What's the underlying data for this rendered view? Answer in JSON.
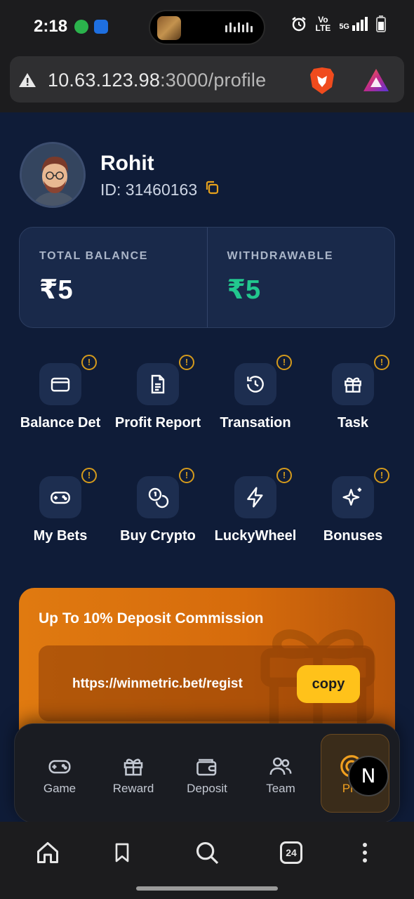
{
  "status_bar": {
    "time": "2:18",
    "network": "5G",
    "volte_line1": "Vo",
    "volte_line2": "LTE"
  },
  "browser": {
    "url_host": "10.63.123.98",
    "url_port": ":3000",
    "url_path": "/profile",
    "tab_count": "24"
  },
  "profile": {
    "name": "Rohit",
    "id_text": "ID: 31460163"
  },
  "balance": {
    "total_label": "TOTAL BALANCE",
    "total_value": "₹5",
    "withdrawable_label": "WITHDRAWABLE",
    "withdrawable_value": "₹5"
  },
  "menu": [
    {
      "label": "Balance Det",
      "icon": "credit-card-icon"
    },
    {
      "label": "Profit Report",
      "icon": "document-icon"
    },
    {
      "label": "Transation",
      "icon": "history-icon"
    },
    {
      "label": "Task",
      "icon": "gift-icon"
    },
    {
      "label": "My Bets",
      "icon": "gamepad-icon"
    },
    {
      "label": "Buy Crypto",
      "icon": "coins-icon"
    },
    {
      "label": "LuckyWheel",
      "icon": "lightning-icon"
    },
    {
      "label": "Bonuses",
      "icon": "sparkles-icon"
    }
  ],
  "badge_glyph": "!",
  "promo": {
    "title": "Up To 10% Deposit Commission",
    "link": "https://winmetric.bet/regist",
    "copy_label": "copy"
  },
  "bottom_nav": [
    {
      "label": "Game",
      "icon": "gamepad-icon"
    },
    {
      "label": "Reward",
      "icon": "gift-icon"
    },
    {
      "label": "Deposit",
      "icon": "wallet-icon"
    },
    {
      "label": "Team",
      "icon": "users-icon"
    },
    {
      "label": "Pro",
      "icon": "profile-icon",
      "active": true
    }
  ],
  "floating_badge": "N",
  "colors": {
    "background": "#0f1c38",
    "card": "#19294a",
    "accent_orange": "#e07a10",
    "accent_yellow": "#ffc21a",
    "badge_gold": "#d49a1c",
    "withdrawable_green": "#22c78e"
  }
}
